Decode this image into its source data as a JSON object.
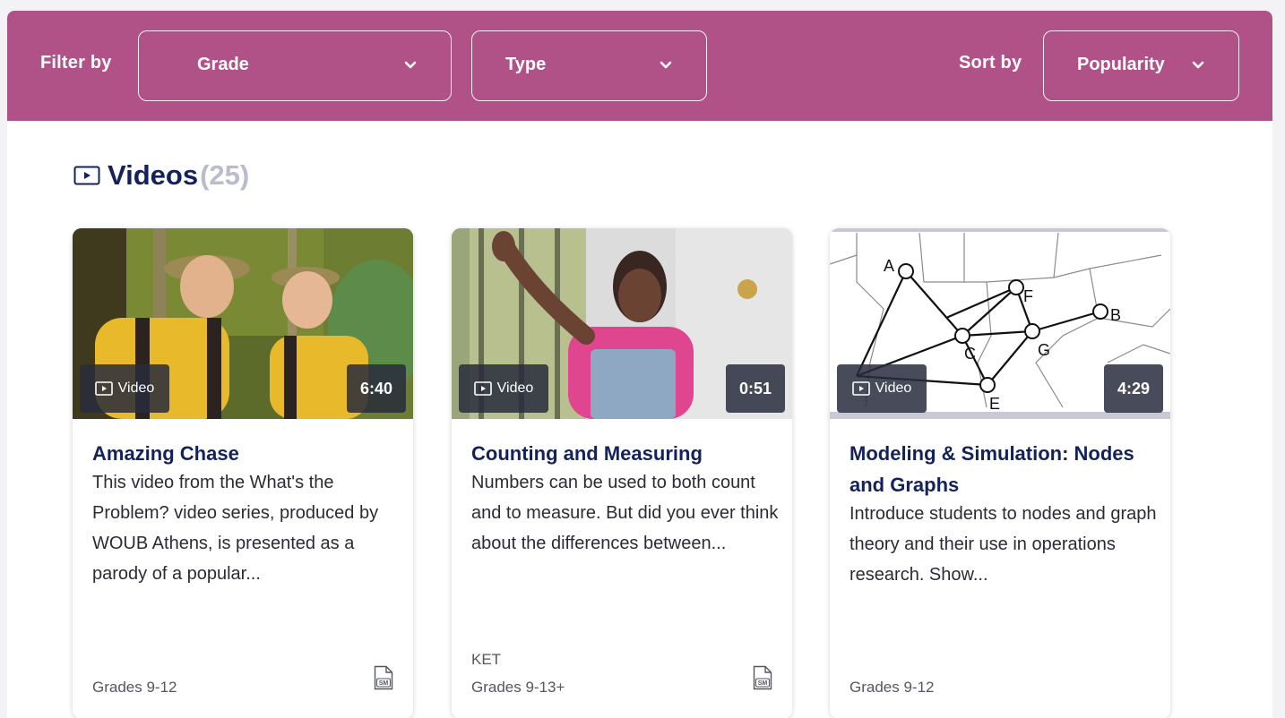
{
  "filters": {
    "filter_by_label": "Filter by",
    "grade_label": "Grade",
    "type_label": "Type",
    "sort_by_label": "Sort by",
    "sort_value": "Popularity"
  },
  "section": {
    "title": "Videos",
    "count": "(25)"
  },
  "cards": [
    {
      "type_badge": "Video",
      "duration": "6:40",
      "title": "Amazing Chase",
      "description": "This video from the What's the Problem? video series, produced by WOUB Athens, is presented as a parody of a popular...",
      "source": "",
      "grades": "Grades 9-12",
      "sm_icon_text": "SM"
    },
    {
      "type_badge": "Video",
      "duration": "0:51",
      "title": "Counting and Measuring",
      "description": "Numbers can be used to both count and to measure. But did you ever think about the differences between...",
      "source": "KET",
      "grades": "Grades 9-13+",
      "sm_icon_text": "SM"
    },
    {
      "type_badge": "Video",
      "duration": "4:29",
      "title": "Modeling & Simulation: Nodes and Graphs",
      "description": "Introduce students to nodes and graph theory and their use in operations research. Show...",
      "source": "",
      "grades": "Grades 9-12",
      "thumb_node_labels": [
        "A",
        "F",
        "B",
        "C",
        "G",
        "E"
      ]
    }
  ],
  "colors": {
    "filter_bar": "#b05287",
    "title_navy": "#14225c",
    "count_gray": "#b9bccd"
  },
  "icons": {
    "section_icon": "video-play-icon",
    "dropdown_icon": "chevron-down-icon",
    "card_icon": "sm-document-icon"
  }
}
